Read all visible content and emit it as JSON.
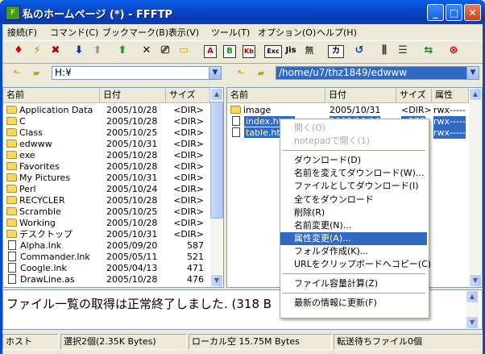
{
  "window": {
    "title": "私のホームページ (*) - FFFTP"
  },
  "menu": [
    "接続(F)",
    "コマンド(C)",
    "ブックマーク(B)",
    "表示(V)",
    "ツール(T)",
    "オプション(O)",
    "ヘルプ(H)"
  ],
  "toolbar": {
    "ascii": "A",
    "binary": "B",
    "kanji": "Kb",
    "exec": "Exc",
    "jis": "Jis",
    "none": "無",
    "kana": "カ"
  },
  "local": {
    "path": "H:¥",
    "headers": [
      "名前",
      "日付",
      "サイズ"
    ],
    "rows": [
      {
        "name": "Application Data",
        "date": "2005/10/28",
        "size": "<DIR>",
        "type": "folder"
      },
      {
        "name": "C",
        "date": "2005/10/28",
        "size": "<DIR>",
        "type": "folder"
      },
      {
        "name": "Class",
        "date": "2005/10/25",
        "size": "<DIR>",
        "type": "folder"
      },
      {
        "name": "edwww",
        "date": "2005/10/31",
        "size": "<DIR>",
        "type": "folder"
      },
      {
        "name": "exe",
        "date": "2005/10/28",
        "size": "<DIR>",
        "type": "folder"
      },
      {
        "name": "Favorites",
        "date": "2005/10/28",
        "size": "<DIR>",
        "type": "folder"
      },
      {
        "name": "My Pictures",
        "date": "2005/10/31",
        "size": "<DIR>",
        "type": "folder"
      },
      {
        "name": "Perl",
        "date": "2005/10/24",
        "size": "<DIR>",
        "type": "folder"
      },
      {
        "name": "RECYCLER",
        "date": "2005/10/28",
        "size": "<DIR>",
        "type": "folder"
      },
      {
        "name": "Scramble",
        "date": "2005/10/25",
        "size": "<DIR>",
        "type": "folder"
      },
      {
        "name": "Working",
        "date": "2005/10/28",
        "size": "<DIR>",
        "type": "folder"
      },
      {
        "name": "デスクトップ",
        "date": "2005/10/31",
        "size": "<DIR>",
        "type": "folder"
      },
      {
        "name": "Alpha.lnk",
        "date": "2005/09/20",
        "size": "587",
        "type": "file"
      },
      {
        "name": "Commander.lnk",
        "date": "2005/05/11",
        "size": "521",
        "type": "file"
      },
      {
        "name": "Coogle.lnk",
        "date": "2005/04/13",
        "size": "471",
        "type": "file"
      },
      {
        "name": "DrawLine.as",
        "date": "2005/10/28",
        "size": "476",
        "type": "file"
      }
    ]
  },
  "remote": {
    "path": "/home/u7/thz1849/edwww",
    "headers": [
      "名前",
      "日付",
      "サイズ",
      "属性"
    ],
    "rows": [
      {
        "name": "image",
        "date": "2005/10/31",
        "size": "<DIR>",
        "attr": "rwx-----",
        "type": "folder"
      },
      {
        "name": "index.html",
        "date": "2005/10/10",
        "size": "275",
        "attr": "rwx-----",
        "type": "file"
      },
      {
        "name": "table.htm",
        "date": "2005/10/10",
        "size": "215",
        "attr": "rwx-----",
        "type": "file"
      }
    ]
  },
  "context_menu": [
    {
      "label": "開く(O)",
      "disabled": true
    },
    {
      "label": "notepadで開く(1)",
      "disabled": true
    },
    {
      "sep": true
    },
    {
      "label": "ダウンロード(D)"
    },
    {
      "label": "名前を変えてダウンロード(W)..."
    },
    {
      "label": "ファイルとしてダウンロード(I)"
    },
    {
      "label": "全てをダウンロード"
    },
    {
      "label": "削除(R)"
    },
    {
      "label": "名前変更(N)..."
    },
    {
      "label": "属性変更(A)...",
      "highlighted": true
    },
    {
      "label": "フォルダ作成(K)..."
    },
    {
      "label": "URLをクリップボードへコピー(C)"
    },
    {
      "sep": true
    },
    {
      "label": "ファイル容量計算(Z)"
    },
    {
      "sep": true
    },
    {
      "label": "最新の情報に更新(F)"
    }
  ],
  "log": {
    "text": "ファイル一覧の取得は正常終了しました. (318 B"
  },
  "status": {
    "host": "ホスト",
    "selection": "選択2個(2.35K Bytes)",
    "local_free": "ローカル空 15.75M Bytes",
    "queue": "転送待ちファイル0個"
  },
  "colors": {
    "selection": "#316ac5",
    "titlebar": "#0846c8"
  }
}
